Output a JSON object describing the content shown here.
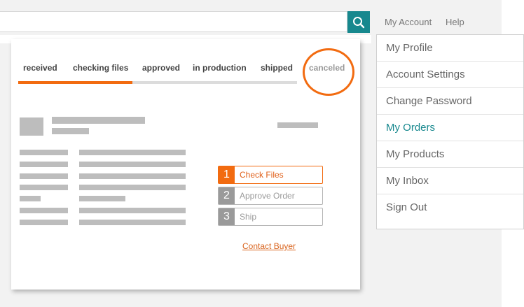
{
  "header": {
    "search": {
      "placeholder": ""
    },
    "links": {
      "account": "My Account",
      "help": "Help"
    }
  },
  "order": {
    "tabs": [
      {
        "label": "received"
      },
      {
        "label": "checking files"
      },
      {
        "label": "approved"
      },
      {
        "label": "in production"
      },
      {
        "label": "shipped"
      },
      {
        "label": "canceled"
      }
    ],
    "progress_fraction": 0.41,
    "steps": [
      {
        "num": "1",
        "label": "Check Files"
      },
      {
        "num": "2",
        "label": "Approve Order"
      },
      {
        "num": "3",
        "label": "Ship"
      }
    ],
    "contact_label": "Contact Buyer"
  },
  "menu": {
    "items": [
      {
        "label": "My Profile"
      },
      {
        "label": "Account Settings"
      },
      {
        "label": "Change Password"
      },
      {
        "label": "My Orders"
      },
      {
        "label": "My Products"
      },
      {
        "label": "My Inbox"
      },
      {
        "label": "Sign Out"
      }
    ],
    "active_item": "My Orders"
  },
  "colors": {
    "accent": "#f26b10",
    "teal": "#17888e",
    "placeholder": "#bdbdbd"
  },
  "icons": {
    "search": "search-icon"
  }
}
